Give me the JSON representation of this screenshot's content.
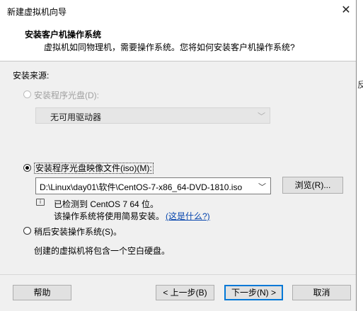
{
  "window": {
    "title": "新建虚拟机向导",
    "close_glyph": "✕"
  },
  "header": {
    "title": "安装客户机操作系统",
    "description": "虚拟机如同物理机，需要操作系统。您将如何安装客户机操作系统?"
  },
  "source": {
    "label": "安装来源:",
    "disc_option": {
      "label": "安装程序光盘(D):",
      "selected": false,
      "enabled": false
    },
    "drive_select": {
      "value": "无可用驱动器",
      "chevron": "﹀"
    },
    "iso_option": {
      "label": "安装程序光盘映像文件(iso)(M):",
      "selected": true
    },
    "iso_path": {
      "value": "D:\\Linux\\day01\\软件\\CentOS-7-x86_64-DVD-1810.iso",
      "chevron": "﹀"
    },
    "browse_label": "浏览(R)...",
    "detected_text": "已检测到 CentOS 7 64 位。",
    "easy_install_text": "该操作系统将使用简易安装。",
    "what_link": "(这是什么?)",
    "later_option": {
      "label": "稍后安装操作系统(S)。",
      "selected": false
    },
    "later_desc": "创建的虚拟机将包含一个空白硬盘。"
  },
  "footer": {
    "help": "帮助",
    "back": "< 上一步(B)",
    "next": "下一步(N) >",
    "cancel": "取消"
  },
  "side_strip_char": "反"
}
